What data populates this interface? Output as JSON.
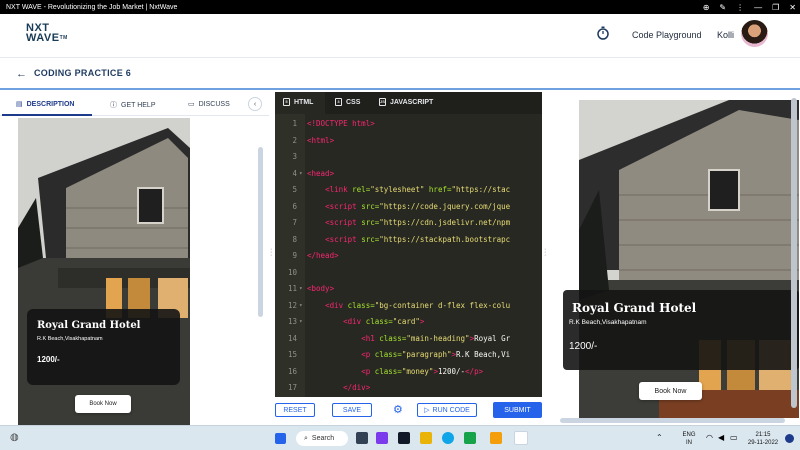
{
  "window": {
    "title": "NXT WAVE - Revolutionizing the Job Market | NxtWave"
  },
  "header": {
    "logo_line1": "NXT",
    "logo_line2": "WAVE",
    "logo_tm": "TM",
    "playground": "Code Playground",
    "username": "Kolli"
  },
  "breadcrumb": {
    "title": "CODING PRACTICE 6"
  },
  "left_tabs": [
    {
      "label": "DESCRIPTION",
      "icon": "book-icon"
    },
    {
      "label": "GET HELP",
      "icon": "help-circle-icon"
    },
    {
      "label": "DISCUSS",
      "icon": "chat-icon"
    }
  ],
  "preview": {
    "heading": "Royal Grand Hotel",
    "paragraph": "R.K Beach,Visakhapatnam",
    "money": "1200/-",
    "button": "Book Now"
  },
  "editor": {
    "tabs": [
      {
        "label": "HTML",
        "badge": "5"
      },
      {
        "label": "CSS",
        "badge": "3"
      },
      {
        "label": "JAVASCRIPT",
        "badge": "JS"
      }
    ],
    "lines": [
      {
        "n": "1",
        "fold": "",
        "parts": [
          [
            "tg",
            "<!DOCTYPE html>"
          ]
        ]
      },
      {
        "n": "2",
        "fold": "",
        "parts": [
          [
            "tg",
            "<html>"
          ]
        ]
      },
      {
        "n": "3",
        "fold": "",
        "parts": []
      },
      {
        "n": "4",
        "fold": "▾",
        "parts": [
          [
            "tg",
            "<head>"
          ]
        ]
      },
      {
        "n": "5",
        "fold": "",
        "parts": [
          [
            "tx",
            "    "
          ],
          [
            "tg",
            "<link "
          ],
          [
            "at",
            "rel="
          ],
          [
            "st",
            "\"stylesheet\" "
          ],
          [
            "at",
            "href="
          ],
          [
            "st",
            "\"https://stac"
          ]
        ]
      },
      {
        "n": "6",
        "fold": "",
        "parts": [
          [
            "tx",
            "    "
          ],
          [
            "tg",
            "<script "
          ],
          [
            "at",
            "src="
          ],
          [
            "st",
            "\"https://code.jquery.com/jque"
          ]
        ]
      },
      {
        "n": "7",
        "fold": "",
        "parts": [
          [
            "tx",
            "    "
          ],
          [
            "tg",
            "<script "
          ],
          [
            "at",
            "src="
          ],
          [
            "st",
            "\"https://cdn.jsdelivr.net/npm"
          ]
        ]
      },
      {
        "n": "8",
        "fold": "",
        "parts": [
          [
            "tx",
            "    "
          ],
          [
            "tg",
            "<script "
          ],
          [
            "at",
            "src="
          ],
          [
            "st",
            "\"https://stackpath.bootstrapc"
          ]
        ]
      },
      {
        "n": "9",
        "fold": "",
        "parts": [
          [
            "tg",
            "</head>"
          ]
        ]
      },
      {
        "n": "10",
        "fold": "",
        "parts": []
      },
      {
        "n": "11",
        "fold": "▾",
        "parts": [
          [
            "tg",
            "<body>"
          ]
        ]
      },
      {
        "n": "12",
        "fold": "▾",
        "parts": [
          [
            "tx",
            "    "
          ],
          [
            "tg",
            "<div "
          ],
          [
            "at",
            "class="
          ],
          [
            "st",
            "\"bg-container d-flex flex-colu"
          ]
        ]
      },
      {
        "n": "13",
        "fold": "▾",
        "parts": [
          [
            "tx",
            "        "
          ],
          [
            "tg",
            "<div "
          ],
          [
            "at",
            "class="
          ],
          [
            "st",
            "\"card\""
          ],
          [
            "tg",
            ">"
          ]
        ]
      },
      {
        "n": "14",
        "fold": "",
        "parts": [
          [
            "tx",
            "            "
          ],
          [
            "tg",
            "<h1 "
          ],
          [
            "at",
            "class="
          ],
          [
            "st",
            "\"main-heading\""
          ],
          [
            "tg",
            ">"
          ],
          [
            "tx",
            "Royal Gr"
          ]
        ]
      },
      {
        "n": "15",
        "fold": "",
        "parts": [
          [
            "tx",
            "            "
          ],
          [
            "tg",
            "<p "
          ],
          [
            "at",
            "class="
          ],
          [
            "st",
            "\"paragraph\""
          ],
          [
            "tg",
            ">"
          ],
          [
            "tx",
            "R.K Beach,Vi"
          ]
        ]
      },
      {
        "n": "16",
        "fold": "",
        "parts": [
          [
            "tx",
            "            "
          ],
          [
            "tg",
            "<p "
          ],
          [
            "at",
            "class="
          ],
          [
            "st",
            "\"money\""
          ],
          [
            "tg",
            ">"
          ],
          [
            "tx",
            "1200/-"
          ],
          [
            "tg",
            "</p>"
          ]
        ]
      },
      {
        "n": "17",
        "fold": "",
        "parts": [
          [
            "tx",
            "        "
          ],
          [
            "tg",
            "</div>"
          ]
        ]
      }
    ]
  },
  "actions": {
    "reset": "RESET",
    "save": "SAVE",
    "run": "RUN CODE",
    "submit": "SUBMIT"
  },
  "taskbar": {
    "search": "Search",
    "lang_line1": "ENG",
    "lang_line2": "IN",
    "time": "21:15",
    "date": "29-11-2022"
  },
  "colors": {
    "accent": "#2563eb",
    "editor_bg": "#272822",
    "brand": "#183b56"
  }
}
